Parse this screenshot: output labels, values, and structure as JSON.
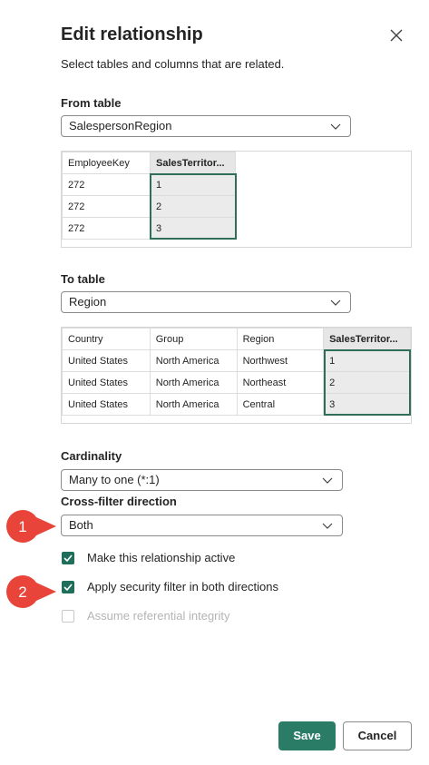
{
  "dialog": {
    "title": "Edit relationship",
    "subtitle": "Select tables and columns that are related."
  },
  "from_table": {
    "label": "From table",
    "selected": "SalespersonRegion",
    "columns": [
      "EmployeeKey",
      "SalesTerritor..."
    ],
    "selected_column": "SalesTerritor...",
    "rows": [
      [
        "272",
        "1"
      ],
      [
        "272",
        "2"
      ],
      [
        "272",
        "3"
      ]
    ]
  },
  "to_table": {
    "label": "To table",
    "selected": "Region",
    "columns": [
      "Country",
      "Group",
      "Region",
      "SalesTerritor..."
    ],
    "selected_column": "SalesTerritor...",
    "rows": [
      [
        "United States",
        "North America",
        "Northwest",
        "1"
      ],
      [
        "United States",
        "North America",
        "Northeast",
        "2"
      ],
      [
        "United States",
        "North America",
        "Central",
        "3"
      ]
    ]
  },
  "cardinality": {
    "label": "Cardinality",
    "selected": "Many to one (*:1)"
  },
  "cross_filter": {
    "label": "Cross-filter direction",
    "selected": "Both"
  },
  "options": [
    {
      "label": "Make this relationship active",
      "checked": true,
      "enabled": true
    },
    {
      "label": "Apply security filter in both directions",
      "checked": true,
      "enabled": true
    },
    {
      "label": "Assume referential integrity",
      "checked": false,
      "enabled": false
    }
  ],
  "callouts": [
    "1",
    "2"
  ],
  "colors": {
    "accent": "#2b7c66",
    "callout": "#e8443a",
    "selection_border": "#2f6f5a"
  },
  "buttons": {
    "save": "Save",
    "cancel": "Cancel"
  }
}
